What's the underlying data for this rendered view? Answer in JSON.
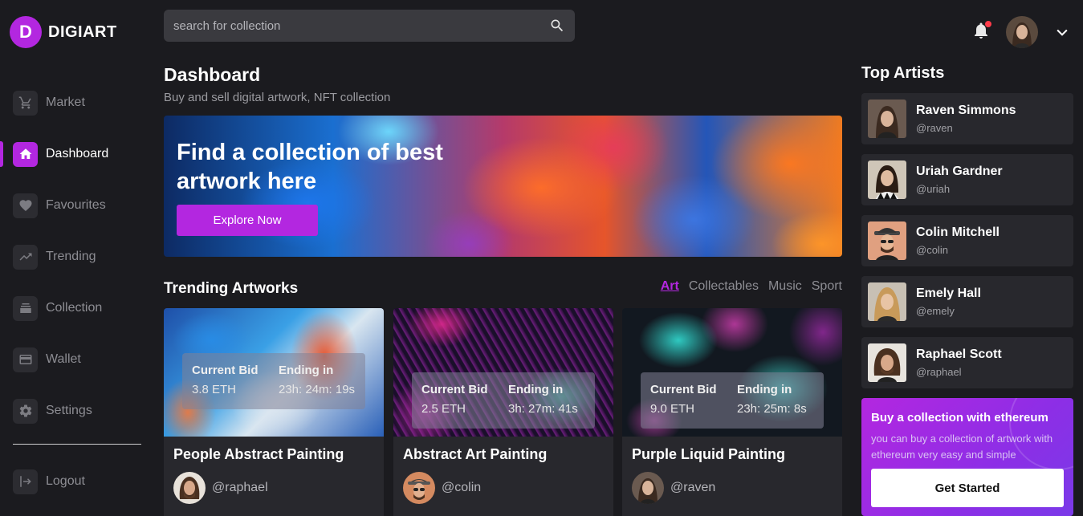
{
  "app": {
    "logo_letter": "D",
    "name": "DIGIART"
  },
  "sidebar": {
    "items": [
      {
        "label": "Market",
        "icon": "cart-icon",
        "active": false
      },
      {
        "label": "Dashboard",
        "icon": "home-icon",
        "active": true
      },
      {
        "label": "Favourites",
        "icon": "heart-icon",
        "active": false
      },
      {
        "label": "Trending",
        "icon": "trending-icon",
        "active": false
      },
      {
        "label": "Collection",
        "icon": "stack-icon",
        "active": false
      },
      {
        "label": "Wallet",
        "icon": "wallet-icon",
        "active": false
      },
      {
        "label": "Settings",
        "icon": "gear-icon",
        "active": false
      }
    ],
    "logout_label": "Logout"
  },
  "header": {
    "search_placeholder": "search for collection",
    "has_notification": true
  },
  "main": {
    "title": "Dashboard",
    "subtitle": "Buy and sell digital artwork, NFT collection",
    "banner": {
      "headline": "Find a collection of best artwork here",
      "button_label": "Explore Now"
    },
    "trending": {
      "title": "Trending Artworks",
      "filters": [
        "Art",
        "Collectables",
        "Music",
        "Sport"
      ],
      "active_filter": "Art",
      "cards": [
        {
          "title": "People Abstract Painting",
          "bid_label": "Current Bid",
          "bid_value": "3.8 ETH",
          "ending_label": "Ending in",
          "ending_value": "23h: 24m: 19s",
          "owner": "@raphael"
        },
        {
          "title": "Abstract Art Painting",
          "bid_label": "Current Bid",
          "bid_value": "2.5 ETH",
          "ending_label": "Ending in",
          "ending_value": "3h: 27m: 41s",
          "owner": "@colin"
        },
        {
          "title": "Purple Liquid Painting",
          "bid_label": "Current Bid",
          "bid_value": "9.0 ETH",
          "ending_label": "Ending in",
          "ending_value": "23h: 25m: 8s",
          "owner": "@raven"
        }
      ]
    }
  },
  "top_artists": {
    "title": "Top Artists",
    "artists": [
      {
        "name": "Raven Simmons",
        "handle": "@raven"
      },
      {
        "name": "Uriah Gardner",
        "handle": "@uriah"
      },
      {
        "name": "Colin Mitchell",
        "handle": "@colin"
      },
      {
        "name": "Emely Hall",
        "handle": "@emely"
      },
      {
        "name": "Raphael Scott",
        "handle": "@raphael"
      }
    ]
  },
  "promo": {
    "title": "Buy a collection with ethereum",
    "text": "you can buy a collection of artwork with ethereum very easy and simple",
    "button_label": "Get Started"
  },
  "colors": {
    "accent": "#b327e0",
    "background": "#1b1b1f",
    "card": "#28282d"
  }
}
